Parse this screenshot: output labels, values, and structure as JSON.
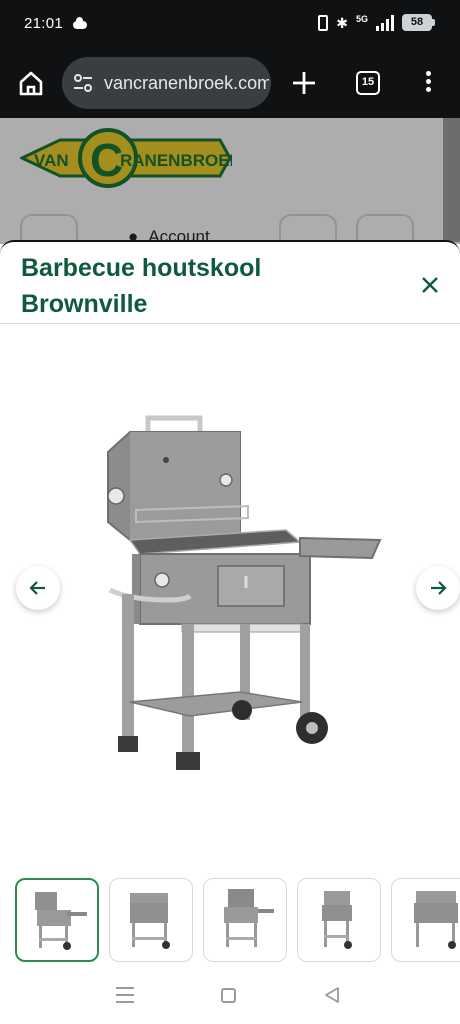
{
  "status_bar": {
    "time": "21:01",
    "network": "5G",
    "battery": "58"
  },
  "browser": {
    "url": "vancranenbroek.com",
    "tab_count": "15"
  },
  "page": {
    "logo_text_left": "VAN",
    "logo_text_big": "C",
    "logo_text_right": "RANENBROEK",
    "account_label": "Account"
  },
  "modal": {
    "title": "Barbecue houtskool Brownville",
    "thumbnail_count": 5,
    "active_thumbnail": 1
  },
  "colors": {
    "brand_green": "#0f5a3b",
    "thumb_active_border": "#2e8b4a",
    "logo_yellow": "#f2d22b",
    "logo_green": "#1d7a3a"
  },
  "icons": [
    "home-icon",
    "site-settings-icon",
    "plus-icon",
    "tabs-icon",
    "more-vert-icon",
    "close-icon",
    "arrow-left-icon",
    "arrow-right-icon"
  ]
}
